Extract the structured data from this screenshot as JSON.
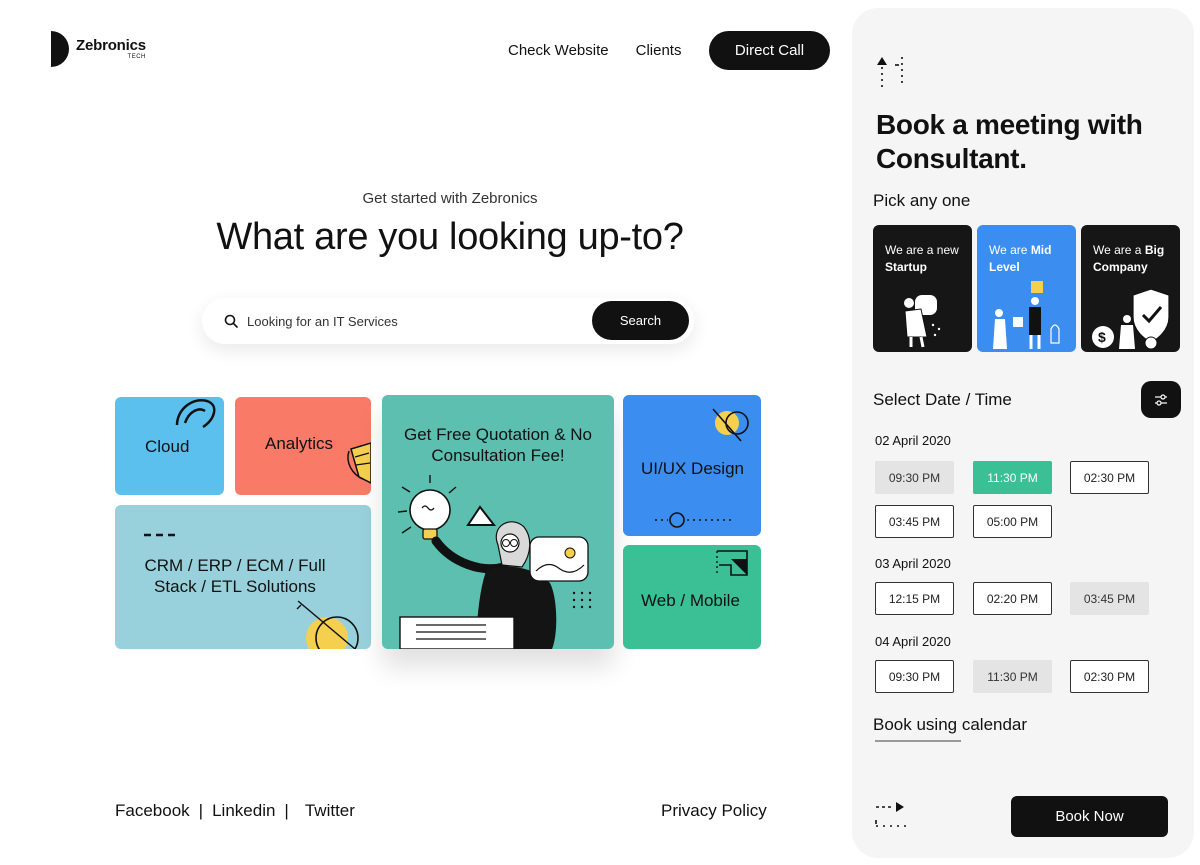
{
  "brand": {
    "name": "Zebronics",
    "sub": "TECH"
  },
  "nav": {
    "check_website": "Check Website",
    "clients": "Clients",
    "direct_call": "Direct Call"
  },
  "hero": {
    "subtitle": "Get started with Zebronics",
    "title": "What are you looking up-to?",
    "search_placeholder": "Looking for an IT Services",
    "search_button": "Search"
  },
  "tiles": {
    "cloud": "Cloud",
    "analytics": "Analytics",
    "crm_line1": "CRM / ERP / ECM / Full",
    "crm_line2": "Stack / ETL Solutions",
    "quote_line1": "Get Free Quotation & No",
    "quote_line2": "Consultation Fee!",
    "uiux": "UI/UX Design",
    "web": "Web / Mobile"
  },
  "colors": {
    "cloud": "#5cc0ef",
    "analytics": "#f97a67",
    "crm": "#98d1dc",
    "quote": "#5cbfb0",
    "uiux": "#3b8ef0",
    "web": "#3bbf95",
    "dark": "#111111",
    "selected_slot": "#3bbf95"
  },
  "footer": {
    "facebook": "Facebook",
    "linkedin": "Linkedin",
    "twitter": "Twitter",
    "sep": "|",
    "privacy": "Privacy Policy"
  },
  "panel": {
    "title": "Book a meeting with Consultant.",
    "pick_label": "Pick any one",
    "segments": [
      {
        "prefix": "We are a new",
        "bold": "Startup"
      },
      {
        "prefix": "We are",
        "bold": "Mid Level"
      },
      {
        "prefix": "We are a",
        "bold": "Big Company"
      }
    ],
    "date_title": "Select Date / Time",
    "days": [
      {
        "date": "02 April 2020",
        "slots": [
          {
            "time": "09:30 PM",
            "state": "disabled"
          },
          {
            "time": "11:30 PM",
            "state": "selected"
          },
          {
            "time": "02:30 PM",
            "state": "available"
          },
          {
            "time": "03:45 PM",
            "state": "available"
          },
          {
            "time": "05:00 PM",
            "state": "available"
          }
        ]
      },
      {
        "date": "03 April 2020",
        "slots": [
          {
            "time": "12:15 PM",
            "state": "available"
          },
          {
            "time": "02:20 PM",
            "state": "available"
          },
          {
            "time": "03:45 PM",
            "state": "disabled"
          }
        ]
      },
      {
        "date": "04 April 2020",
        "slots": [
          {
            "time": "09:30 PM",
            "state": "available"
          },
          {
            "time": "11:30 PM",
            "state": "disabled"
          },
          {
            "time": "02:30 PM",
            "state": "available"
          }
        ]
      }
    ],
    "calendar_link": "Book using calendar",
    "book_button": "Book Now"
  }
}
